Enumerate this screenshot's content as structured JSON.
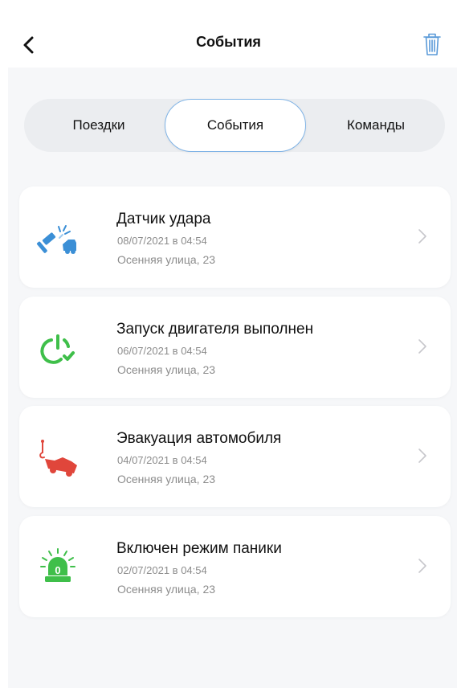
{
  "header": {
    "title": "События",
    "back_icon": "chevron-left-icon",
    "trash_icon": "trash-icon"
  },
  "tabs": [
    {
      "label": "Поездки",
      "active": false
    },
    {
      "label": "События",
      "active": true
    },
    {
      "label": "Команды",
      "active": false
    }
  ],
  "events": [
    {
      "title": "Датчик удара",
      "date": "08/07/2021 в 04:54",
      "address": "Осенняя улица, 23",
      "icon": "impact-sensor-icon",
      "icon_color": "#3b8fd6"
    },
    {
      "title": "Запуск двигателя выполнен",
      "date": "06/07/2021 в 04:54",
      "address": "Осенняя улица, 23",
      "icon": "engine-start-icon",
      "icon_color": "#3fbf4a"
    },
    {
      "title": "Эвакуация автомобиля",
      "date": "04/07/2021 в 04:54",
      "address": "Осенняя улица, 23",
      "icon": "tow-truck-icon",
      "icon_color": "#e0463b"
    },
    {
      "title": "Включен режим паники",
      "date": "02/07/2021 в 04:54",
      "address": "Осенняя улица, 23",
      "icon": "panic-alarm-icon",
      "icon_color": "#3fbf4a"
    }
  ],
  "colors": {
    "accent": "#7fb3e6",
    "trash": "#5a9ad8",
    "background": "#f6f7f9",
    "text_secondary": "#8c8c8c"
  }
}
